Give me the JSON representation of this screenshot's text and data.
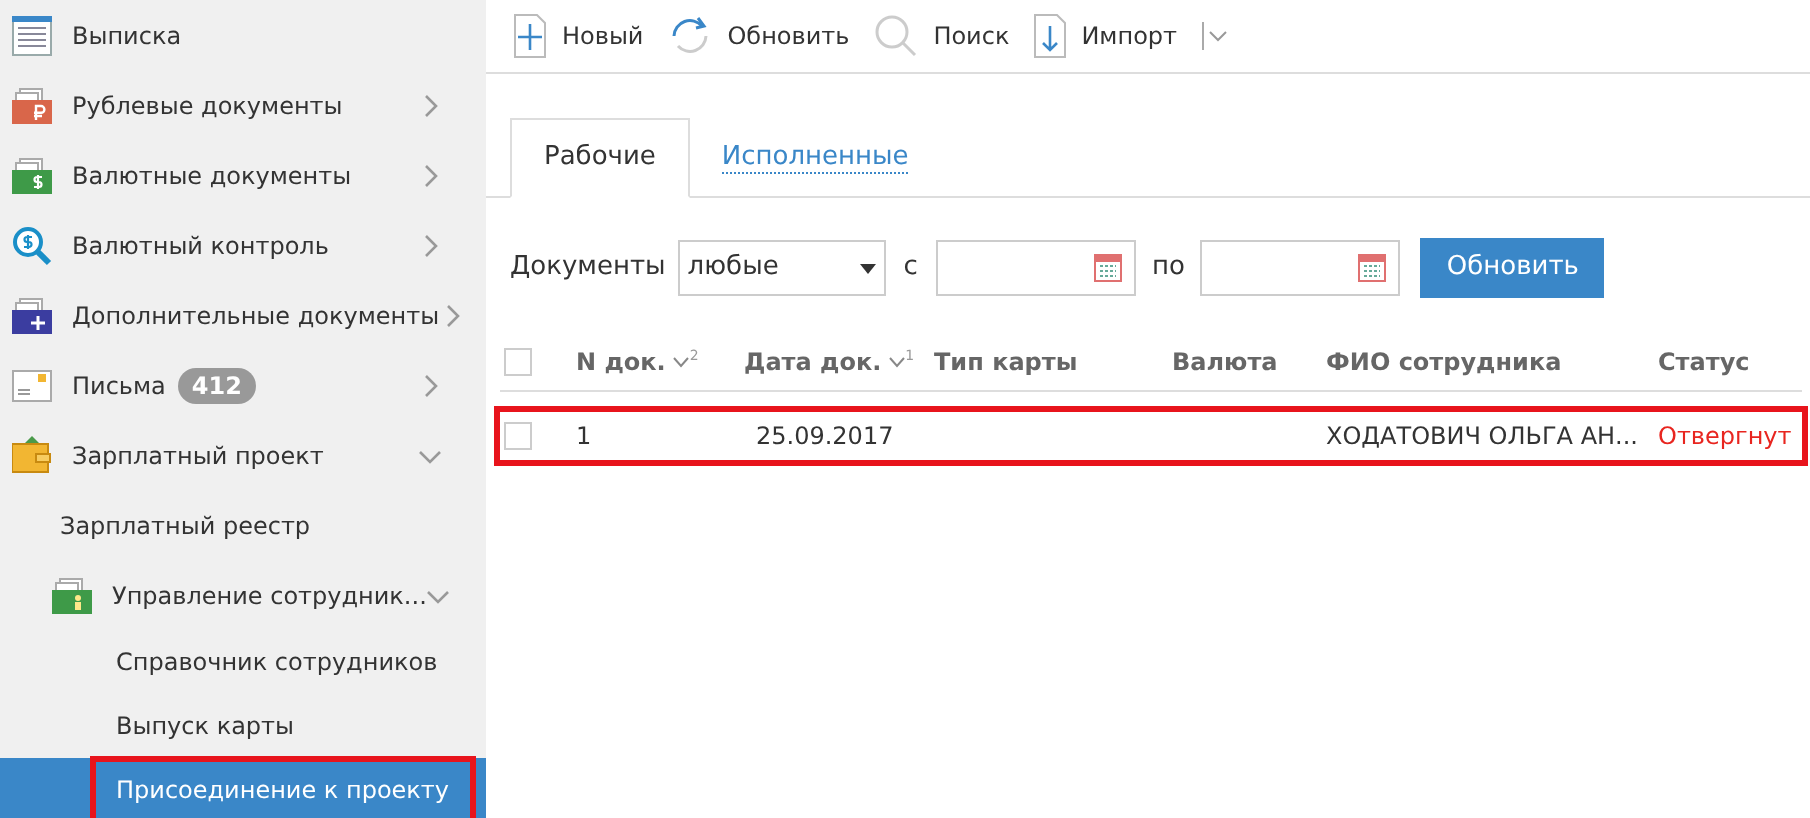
{
  "sidebar": {
    "items": [
      {
        "label": "Выписка",
        "kind": "statement",
        "selected": false,
        "highlighted": false
      },
      {
        "label": "Рублевые документы",
        "kind": "ruble",
        "expanded": false,
        "selected": false,
        "highlighted": false
      },
      {
        "label": "Валютные документы",
        "kind": "dollar",
        "expanded": false,
        "selected": false,
        "highlighted": false
      },
      {
        "label": "Валютный контроль",
        "kind": "search-dollar",
        "expanded": false,
        "selected": false,
        "highlighted": false
      },
      {
        "label": "Дополнительные документы",
        "kind": "plus-folder",
        "expanded": false,
        "selected": false,
        "highlighted": false
      },
      {
        "label": "Письма",
        "kind": "letter",
        "badge": "412",
        "expanded": false,
        "selected": false,
        "highlighted": false
      },
      {
        "label": "Зарплатный проект",
        "kind": "wallet",
        "expanded": true,
        "selected": false,
        "highlighted": false,
        "children": [
          {
            "label": "Зарплатный реестр",
            "selected": false,
            "highlighted": false
          },
          {
            "label": "Управление сотрудник...",
            "kind": "person-folder",
            "expanded": true,
            "selected": false,
            "highlighted": false,
            "children": [
              {
                "label": "Справочник сотрудников",
                "selected": false,
                "highlighted": false
              },
              {
                "label": "Выпуск карты",
                "selected": false,
                "highlighted": false
              },
              {
                "label": "Присоединение к проекту",
                "selected": true,
                "highlighted": true
              }
            ]
          }
        ]
      }
    ]
  },
  "toolbar": [
    {
      "label": "Новый",
      "kind": "plus"
    },
    {
      "label": "Обновить",
      "kind": "refresh"
    },
    {
      "label": "Поиск",
      "kind": "search"
    },
    {
      "label": "Импорт",
      "kind": "import",
      "menu": true
    }
  ],
  "tabs": [
    {
      "label": "Рабочие",
      "selected": true
    },
    {
      "label": "Исполненные",
      "selected": false
    }
  ],
  "filter": {
    "documents_label": "Документы",
    "documents_value": "любые",
    "from_label": "с",
    "to_label": "по",
    "button": "Обновить"
  },
  "table": {
    "select_all_checked": false,
    "columns": [
      {
        "label": "N док.",
        "sort": "2"
      },
      {
        "label": "Дата док.",
        "sort": "1"
      },
      {
        "label": "Тип карты"
      },
      {
        "label": "Валюта"
      },
      {
        "label": "ФИО сотрудника"
      },
      {
        "label": "Статус"
      }
    ],
    "rows": [
      {
        "checked": false,
        "highlighted": true,
        "cells": [
          "1",
          "25.09.2017",
          "",
          "",
          "ХОДАТОВИЧ ОЛЬГА АН...",
          "Отвергнут"
        ],
        "kind": "rejected"
      }
    ]
  }
}
